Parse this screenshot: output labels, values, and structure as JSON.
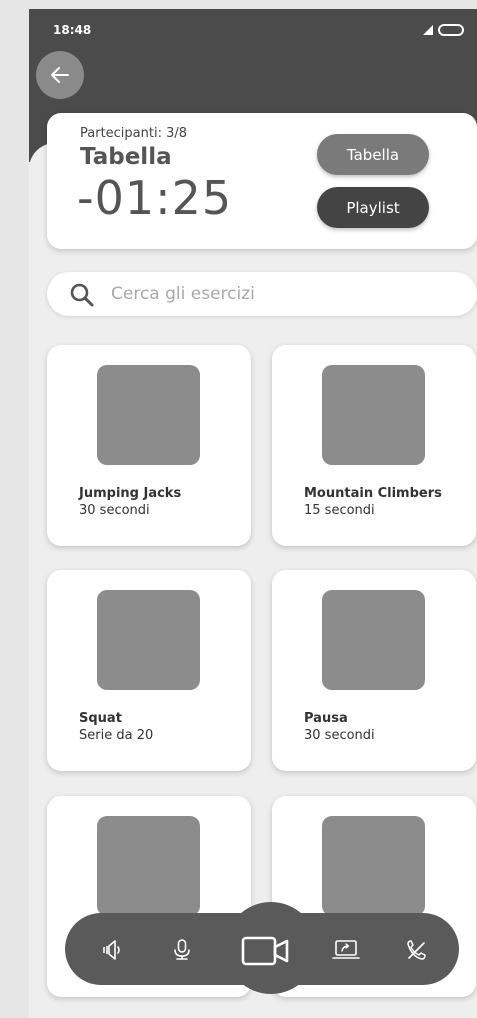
{
  "status_bar": {
    "time": "18:48"
  },
  "header": {
    "back_icon": "arrow-left-icon"
  },
  "session": {
    "participants": "Partecipanti: 3/8",
    "title": "Tabella",
    "timer": "-01:25",
    "buttons": {
      "tabella": "Tabella",
      "playlist": "Playlist"
    }
  },
  "search": {
    "placeholder": "Cerca gli esercizi",
    "value": ""
  },
  "exercises": [
    {
      "name": "Jumping Jacks",
      "detail": "30 secondi"
    },
    {
      "name": "Mountain Climbers",
      "detail": "15 secondi"
    },
    {
      "name": "Squat",
      "detail": "Serie da 20"
    },
    {
      "name": "Pausa",
      "detail": "30 secondi"
    }
  ],
  "toolbar": {
    "icons": [
      "speaker-icon",
      "microphone-icon",
      "video-camera-icon",
      "screen-share-icon",
      "end-call-icon"
    ]
  },
  "colors": {
    "header": "#4b4b4b",
    "background": "#eeeeee",
    "thumbnail": "#8c8c8c",
    "toolbar": "#5a5a5a"
  }
}
